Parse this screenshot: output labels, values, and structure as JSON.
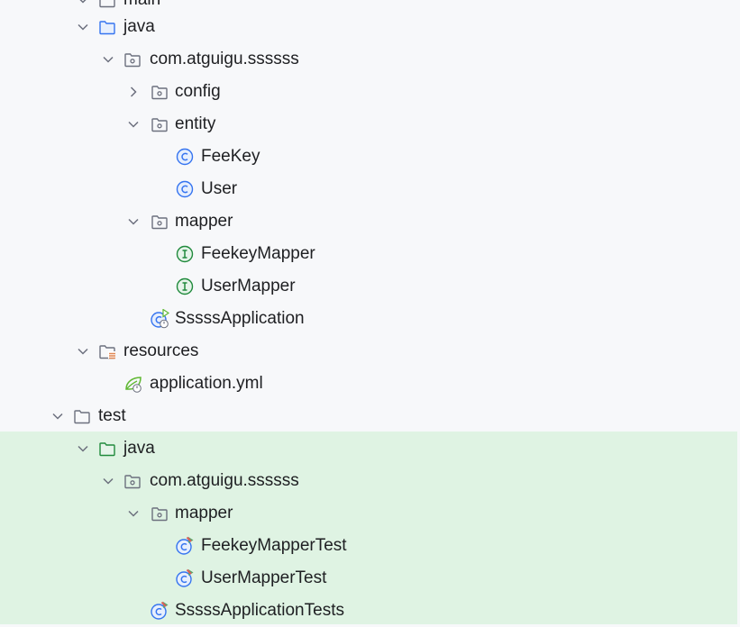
{
  "project_tree": {
    "items": [
      {
        "label": "main",
        "icon": "folder-icon",
        "expand": "expanded"
      },
      {
        "label": "java",
        "icon": "source-folder-icon",
        "expand": "expanded"
      },
      {
        "label": "com.atguigu.ssssss",
        "icon": "package-icon",
        "expand": "expanded"
      },
      {
        "label": "config",
        "icon": "package-icon",
        "expand": "collapsed"
      },
      {
        "label": "entity",
        "icon": "package-icon",
        "expand": "expanded"
      },
      {
        "label": "FeeKey",
        "icon": "class-icon",
        "expand": "none"
      },
      {
        "label": "User",
        "icon": "class-icon",
        "expand": "none"
      },
      {
        "label": "mapper",
        "icon": "package-icon",
        "expand": "expanded"
      },
      {
        "label": "FeekeyMapper",
        "icon": "interface-icon",
        "expand": "none"
      },
      {
        "label": "UserMapper",
        "icon": "interface-icon",
        "expand": "none"
      },
      {
        "label": "SssssApplication",
        "icon": "spring-boot-app-class-icon",
        "expand": "none"
      },
      {
        "label": "resources",
        "icon": "resources-folder-icon",
        "expand": "expanded"
      },
      {
        "label": "application.yml",
        "icon": "spring-yml-icon",
        "expand": "none"
      },
      {
        "label": "test",
        "icon": "folder-icon",
        "expand": "expanded"
      },
      {
        "label": "java",
        "icon": "test-source-folder-icon",
        "expand": "expanded"
      },
      {
        "label": "com.atguigu.ssssss",
        "icon": "package-icon",
        "expand": "expanded"
      },
      {
        "label": "mapper",
        "icon": "package-icon",
        "expand": "expanded"
      },
      {
        "label": "FeekeyMapperTest",
        "icon": "test-class-icon",
        "expand": "none"
      },
      {
        "label": "UserMapperTest",
        "icon": "test-class-icon",
        "expand": "none"
      },
      {
        "label": "SssssApplicationTests",
        "icon": "test-class-icon",
        "expand": "none"
      }
    ]
  },
  "colors": {
    "panel_background": "#f7f8fa",
    "test_sources_highlight": "#dff3e3",
    "text": "#1e1f22",
    "class_icon": "#3574f0",
    "interface_icon": "#208a3c",
    "source_folder_icon": "#3574f0",
    "test_folder_icon": "#208a3c",
    "resources_accent": "#e08855",
    "spring_icon": "#5fb832",
    "chevron": "#6c707e"
  }
}
